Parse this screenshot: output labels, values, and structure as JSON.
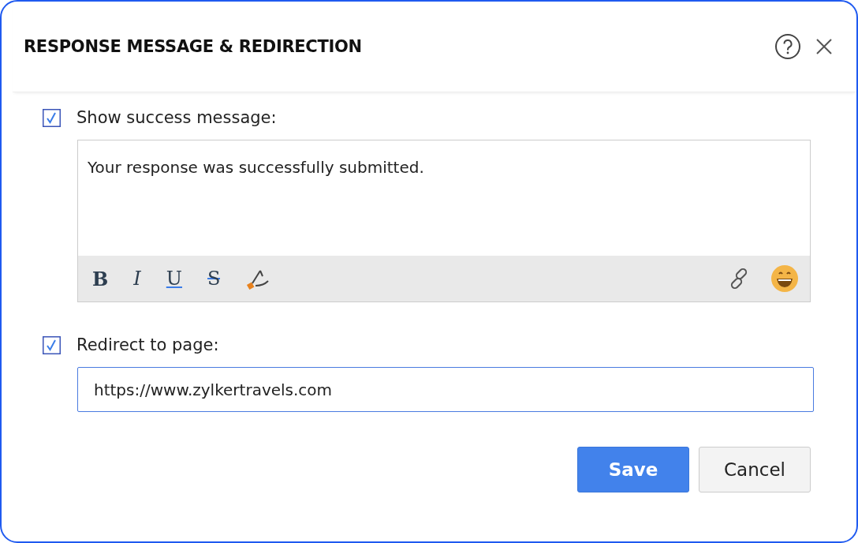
{
  "dialog": {
    "title": "RESPONSE MESSAGE & REDIRECTION"
  },
  "success_message": {
    "label": "Show success message:",
    "checked": true,
    "value": "Your response was successfully submitted.",
    "format_buttons": [
      "B",
      "I",
      "U",
      "S"
    ]
  },
  "redirect": {
    "label": "Redirect to page:",
    "checked": true,
    "value": "https://www.zylkertravels.com"
  },
  "buttons": [
    {
      "label": "Save",
      "kind": "primary"
    },
    {
      "label": "Cancel",
      "kind": "secondary"
    }
  ]
}
